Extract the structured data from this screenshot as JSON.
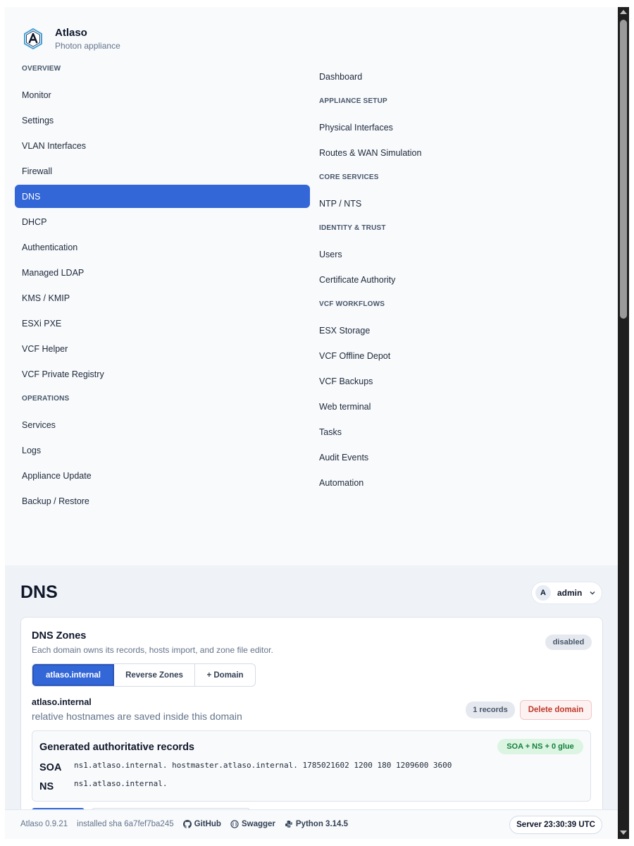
{
  "brand": {
    "title": "Atlaso",
    "subtitle": "Photon appliance",
    "logo_icon": "atlaso-hexagon-logo"
  },
  "nav": {
    "left": [
      {
        "kind": "section",
        "label": "OVERVIEW"
      },
      {
        "kind": "item",
        "label": "Monitor"
      },
      {
        "kind": "item",
        "label": "Settings"
      },
      {
        "kind": "item",
        "label": "VLAN Interfaces"
      },
      {
        "kind": "item",
        "label": "Firewall"
      },
      {
        "kind": "item",
        "label": "DNS",
        "active": true
      },
      {
        "kind": "item",
        "label": "DHCP"
      },
      {
        "kind": "item",
        "label": "Authentication"
      },
      {
        "kind": "item",
        "label": "Managed LDAP"
      },
      {
        "kind": "item",
        "label": "KMS / KMIP"
      },
      {
        "kind": "item",
        "label": "ESXi PXE"
      },
      {
        "kind": "item",
        "label": "VCF Helper"
      },
      {
        "kind": "item",
        "label": "VCF Private Registry"
      },
      {
        "kind": "section",
        "label": "OPERATIONS"
      },
      {
        "kind": "item",
        "label": "Services"
      },
      {
        "kind": "item",
        "label": "Logs"
      },
      {
        "kind": "item",
        "label": "Appliance Update"
      },
      {
        "kind": "item",
        "label": "Backup / Restore"
      }
    ],
    "right": [
      {
        "kind": "item",
        "label": "Dashboard"
      },
      {
        "kind": "section",
        "label": "APPLIANCE SETUP"
      },
      {
        "kind": "item",
        "label": "Physical Interfaces"
      },
      {
        "kind": "item",
        "label": "Routes & WAN Simulation"
      },
      {
        "kind": "section",
        "label": "CORE SERVICES"
      },
      {
        "kind": "item",
        "label": "NTP / NTS"
      },
      {
        "kind": "section",
        "label": "IDENTITY & TRUST"
      },
      {
        "kind": "item",
        "label": "Users"
      },
      {
        "kind": "item",
        "label": "Certificate Authority"
      },
      {
        "kind": "section",
        "label": "VCF WORKFLOWS"
      },
      {
        "kind": "item",
        "label": "ESX Storage"
      },
      {
        "kind": "item",
        "label": "VCF Offline Depot"
      },
      {
        "kind": "item",
        "label": "VCF Backups"
      },
      {
        "kind": "item",
        "label": "Web terminal"
      },
      {
        "kind": "item",
        "label": "Tasks"
      },
      {
        "kind": "item",
        "label": "Audit Events"
      },
      {
        "kind": "item",
        "label": "Automation"
      }
    ]
  },
  "header": {
    "page_title": "DNS",
    "user": {
      "avatar_letter": "A",
      "name": "admin",
      "menu_icon": "chevron-down-icon"
    }
  },
  "zones_card": {
    "title": "DNS Zones",
    "subtitle": "Each domain owns its records, hosts import, and zone file editor.",
    "status_badge": "disabled",
    "tabs": [
      {
        "label": "atlaso.internal",
        "active": true
      },
      {
        "label": "Reverse Zones",
        "active": false
      },
      {
        "label": "+ Domain",
        "active": false
      }
    ],
    "domain": {
      "name": "atlaso.internal",
      "note": "relative hostnames are saved inside this domain",
      "records_badge": "1 records",
      "delete_label": "Delete domain"
    },
    "generated": {
      "title": "Generated authoritative records",
      "summary_badge": "SOA + NS + 0 glue",
      "records": [
        {
          "type": "SOA",
          "value": "ns1.atlaso.internal. hostmaster.atlaso.internal. 1785021602 1200 180 1209600 3600"
        },
        {
          "type": "NS",
          "value": "ns1.atlaso.internal."
        }
      ]
    }
  },
  "footer": {
    "version": "Atlaso 0.9.21",
    "installed": "installed sha 6a7fef7ba245",
    "links": [
      {
        "label": "GitHub",
        "icon": "github-icon"
      },
      {
        "label": "Swagger",
        "icon": "swagger-icon"
      },
      {
        "label": "Python 3.14.5",
        "icon": "python-icon"
      }
    ],
    "server_time": "Server 23:30:39 UTC"
  },
  "colors": {
    "accent": "#3366d6",
    "sidebar_bg": "#f8fafc",
    "main_bg": "#eff3f7",
    "danger": "#c0392b",
    "success": "#15803d"
  }
}
